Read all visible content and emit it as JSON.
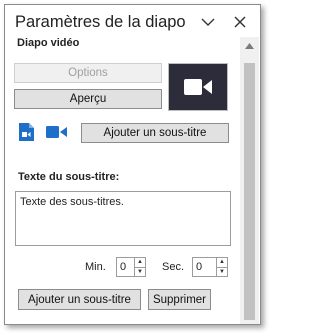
{
  "pane": {
    "title": "Paramètres de la diapo",
    "icons": {
      "collapse": "chevron-down-icon",
      "close": "close-icon"
    }
  },
  "video": {
    "section_label": "Diapo vidéo",
    "options_label": "Options",
    "preview_label": "Aperçu",
    "tile_icon": "video-camera-icon",
    "tile_color": "#2c2c3a"
  },
  "subtitle_tools": {
    "icon_file": "video-file-icon",
    "icon_camera": "video-camera-icon",
    "add_label": "Ajouter un sous-titre",
    "accent": "#1e6fc8"
  },
  "subtitle_text": {
    "label": "Texte du sous-titre:",
    "value": "Texte des sous-titres."
  },
  "timing": {
    "min_label": "Min.",
    "min_value": "0",
    "sec_label": "Sec.",
    "sec_value": "0"
  },
  "actions": {
    "add_label": "Ajouter un sous-titre",
    "delete_label": "Supprimer"
  }
}
